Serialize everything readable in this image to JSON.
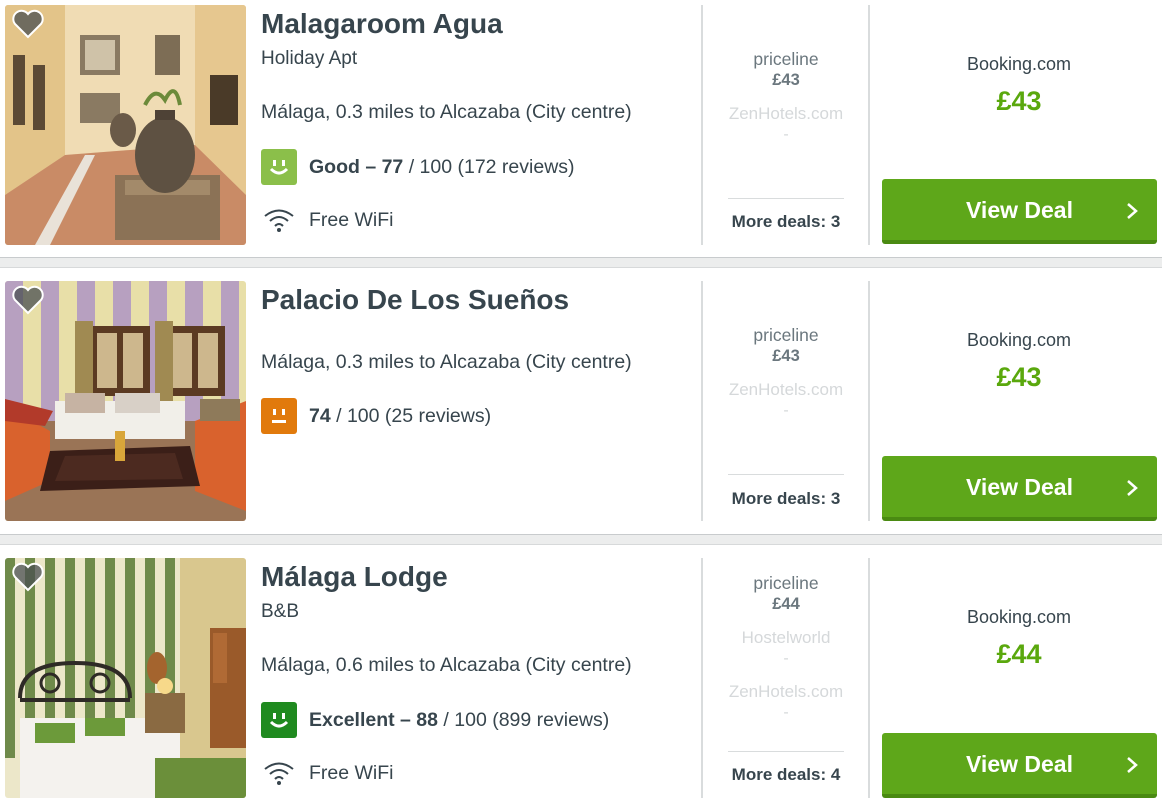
{
  "hotels": [
    {
      "name": "Malagaroom Agua",
      "type": "Holiday Apt",
      "location": "Málaga, 0.3 miles to Alcazaba (City centre)",
      "rating": {
        "label": "Good – 77",
        "rest": " / 100 (172 reviews)",
        "color": "#8bbf4a",
        "mood": "happy"
      },
      "amenity": "Free WiFi",
      "providers": [
        {
          "name": "priceline",
          "price": "£43",
          "active": true
        },
        {
          "name": "ZenHotels.com",
          "price": "-",
          "active": false
        }
      ],
      "more_deals": "More deals: 3",
      "best_provider": "Booking.com",
      "best_price": "£43",
      "cta": "View Deal"
    },
    {
      "name": "Palacio De Los Sueños",
      "type": "",
      "location": "Málaga, 0.3 miles to Alcazaba (City centre)",
      "rating": {
        "label": "74",
        "rest": " / 100 (25 reviews)",
        "color": "#e17a0c",
        "mood": "neutral"
      },
      "amenity": "",
      "providers": [
        {
          "name": "priceline",
          "price": "£43",
          "active": true
        },
        {
          "name": "ZenHotels.com",
          "price": "-",
          "active": false
        }
      ],
      "more_deals": "More deals: 3",
      "best_provider": "Booking.com",
      "best_price": "£43",
      "cta": "View Deal"
    },
    {
      "name": "Málaga Lodge",
      "type": "B&B",
      "location": "Málaga, 0.6 miles to Alcazaba (City centre)",
      "rating": {
        "label": "Excellent – 88",
        "rest": " / 100 (899 reviews)",
        "color": "#1f8a1f",
        "mood": "happy"
      },
      "amenity": "Free WiFi",
      "providers": [
        {
          "name": "priceline",
          "price": "£44",
          "active": true
        },
        {
          "name": "Hostelworld",
          "price": "-",
          "active": false
        },
        {
          "name": "ZenHotels.com",
          "price": "-",
          "active": false
        }
      ],
      "more_deals": "More deals: 4",
      "best_provider": "Booking.com",
      "best_price": "£44",
      "cta": "View Deal"
    }
  ],
  "icons": {
    "favorite": "heart-icon",
    "wifi": "wifi-icon",
    "chevron": "chevron-right-icon"
  },
  "colors": {
    "accent_green": "#5ea71a",
    "price_green": "#5aa80d",
    "text": "#37454d"
  }
}
